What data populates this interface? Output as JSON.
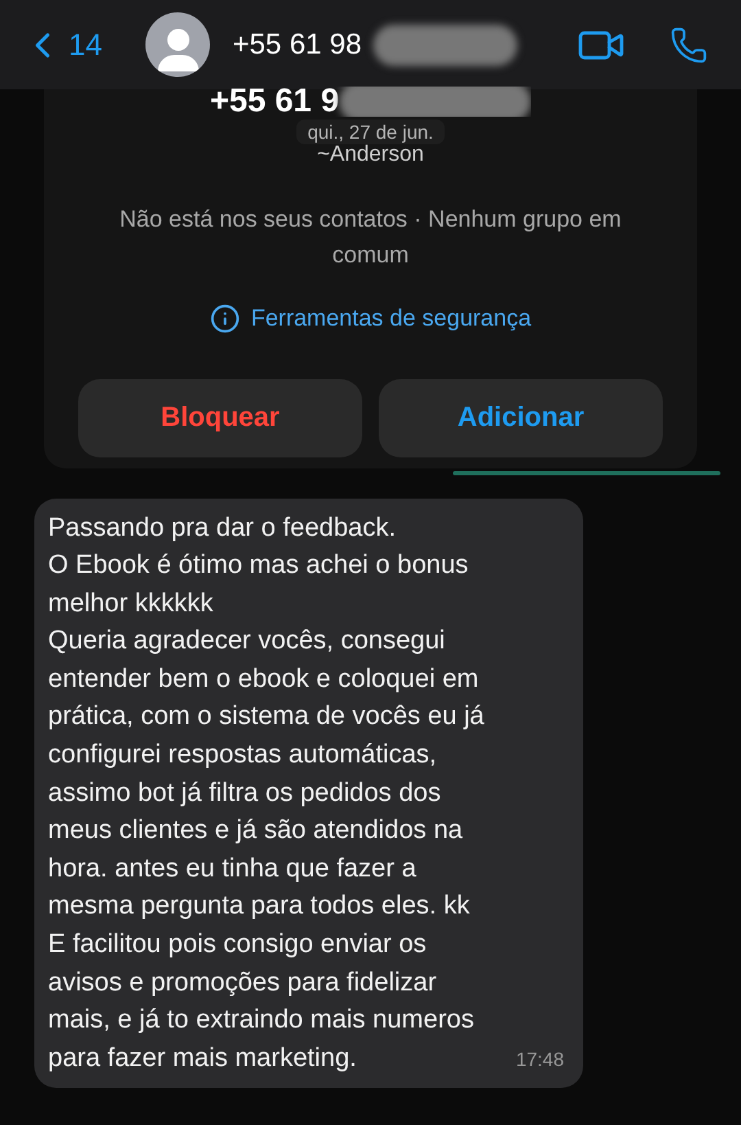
{
  "header": {
    "back_count": "14",
    "contact_name": "+55 61 98"
  },
  "contact_card": {
    "name": "+55 61 9",
    "date_pill": "qui., 27 de jun.",
    "push_name": "~Anderson",
    "info": "Não está nos seus contatos · Nenhum grupo em comum",
    "safety_link": "Ferramentas de segurança",
    "buttons": [
      {
        "label": "Bloquear",
        "kind": "danger"
      },
      {
        "label": "Adicionar",
        "kind": "primary"
      }
    ]
  },
  "messages": [
    {
      "text": "Passando pra dar o feedback.\nO Ebook é ótimo mas achei o bonus\nmelhor kkkkkk\nQueria agradecer vocês, consegui\nentender bem o ebook e coloquei em\nprática, com o sistema de vocês eu já\nconfigurei respostas automáticas,\nassimo bot já filtra os pedidos dos\nmeus clientes e já são atendidos na\nhora. antes eu tinha que fazer a\nmesma pergunta para todos eles. kk\nE facilitou pois consigo enviar os\navisos e promoções para fidelizar\nmais, e já to extraindo mais numeros\npara fazer mais marketing.",
      "time": "17:48"
    }
  ]
}
